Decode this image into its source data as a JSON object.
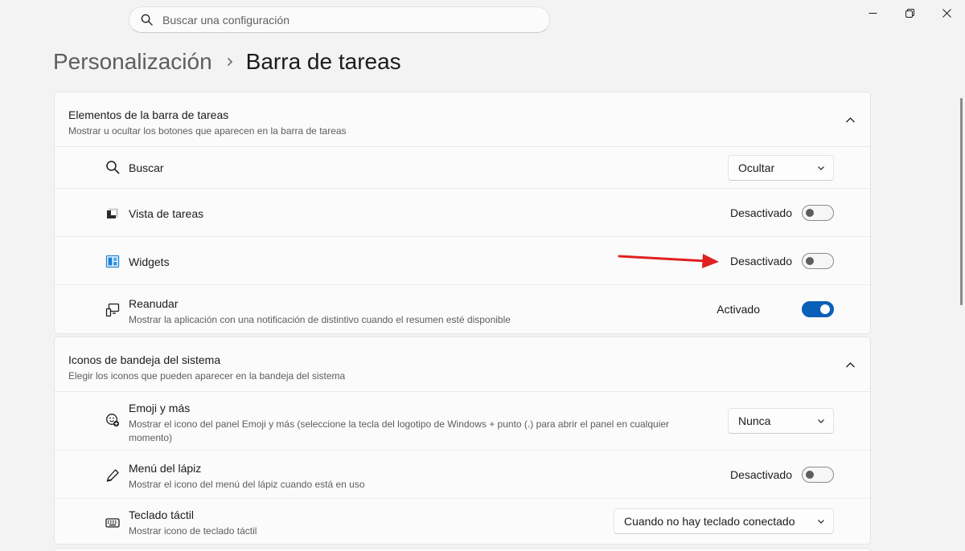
{
  "search": {
    "placeholder": "Buscar una configuración"
  },
  "breadcrumb": {
    "parent": "Personalización",
    "current": "Barra de tareas"
  },
  "colors": {
    "accent": "#0a5fb8",
    "annotation_arrow": "#e02020"
  },
  "taskbar_items": {
    "title": "Elementos de la barra de tareas",
    "subtitle": "Mostrar u ocultar los botones que aparecen en la barra de tareas",
    "rows": [
      {
        "label": "Buscar",
        "icon": "search-icon",
        "control": "dropdown",
        "value": "Ocultar"
      },
      {
        "label": "Vista de tareas",
        "icon": "task-view-icon",
        "control": "toggle",
        "state": "Desactivado",
        "on": false
      },
      {
        "label": "Widgets",
        "icon": "widgets-icon",
        "control": "toggle",
        "state": "Desactivado",
        "on": false
      },
      {
        "label": "Reanudar",
        "description": "Mostrar la aplicación con una notificación de distintivo cuando el resumen esté disponible",
        "icon": "resume-icon",
        "control": "toggle",
        "state": "Activado",
        "on": true
      }
    ]
  },
  "system_tray": {
    "title": "Iconos de bandeja del sistema",
    "subtitle": "Elegir los iconos que pueden aparecer en la bandeja del sistema",
    "rows": [
      {
        "label": "Emoji y más",
        "description": "Mostrar el icono del panel Emoji y más (seleccione la tecla del logotipo de Windows + punto (.) para abrir el panel en cualquier momento)",
        "icon": "emoji-icon",
        "control": "dropdown",
        "value": "Nunca"
      },
      {
        "label": "Menú del lápiz",
        "description": "Mostrar el icono del menú del lápiz cuando está en uso",
        "icon": "pen-icon",
        "control": "toggle",
        "state": "Desactivado",
        "on": false
      },
      {
        "label": "Teclado táctil",
        "description": "Mostrar icono de teclado táctil",
        "icon": "keyboard-icon",
        "control": "dropdown",
        "value": "Cuando no hay teclado conectado"
      }
    ]
  }
}
